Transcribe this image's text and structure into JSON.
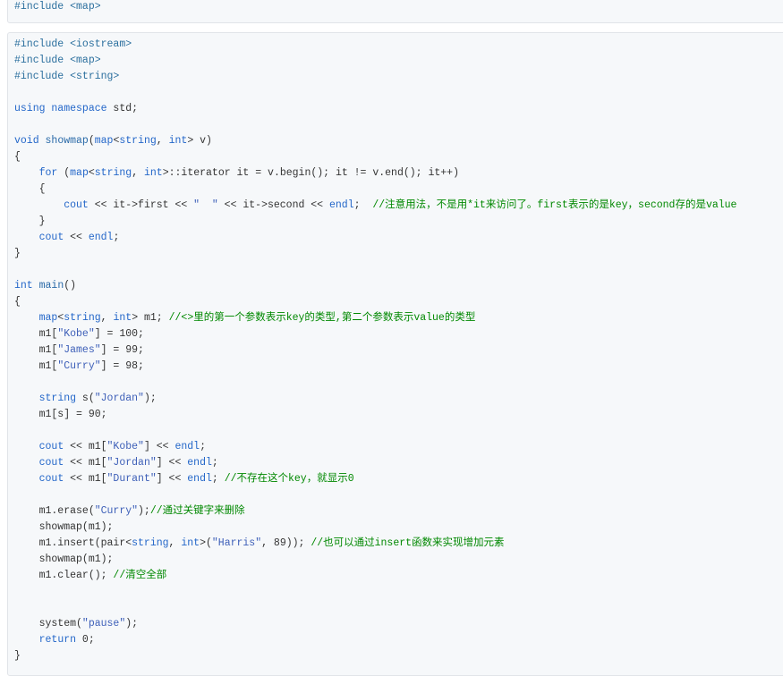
{
  "snippet": {
    "lines": [
      [
        {
          "t": "#include <map>",
          "c": "pre"
        }
      ]
    ]
  },
  "program": {
    "lines": [
      [
        {
          "t": "#include <iostream>",
          "c": "pre"
        }
      ],
      [
        {
          "t": "#include <map>",
          "c": "pre"
        }
      ],
      [
        {
          "t": "#include <string>",
          "c": "pre"
        }
      ],
      [],
      [
        {
          "t": "using namespace",
          "c": "kw"
        },
        {
          "t": " std;",
          "c": ""
        }
      ],
      [],
      [
        {
          "t": "void",
          "c": "kw"
        },
        {
          "t": " ",
          "c": ""
        },
        {
          "t": "showmap",
          "c": "fn"
        },
        {
          "t": "(",
          "c": ""
        },
        {
          "t": "map",
          "c": "kw"
        },
        {
          "t": "<",
          "c": ""
        },
        {
          "t": "string",
          "c": "kw"
        },
        {
          "t": ", ",
          "c": ""
        },
        {
          "t": "int",
          "c": "kw"
        },
        {
          "t": "> v)",
          "c": ""
        }
      ],
      [
        {
          "t": "{",
          "c": ""
        }
      ],
      [
        {
          "t": "    ",
          "c": ""
        },
        {
          "t": "for",
          "c": "kw"
        },
        {
          "t": " (",
          "c": ""
        },
        {
          "t": "map",
          "c": "kw"
        },
        {
          "t": "<",
          "c": ""
        },
        {
          "t": "string",
          "c": "kw"
        },
        {
          "t": ", ",
          "c": ""
        },
        {
          "t": "int",
          "c": "kw"
        },
        {
          "t": ">::iterator it = v.begin(); it != v.end(); it++)",
          "c": ""
        }
      ],
      [
        {
          "t": "    {",
          "c": ""
        }
      ],
      [
        {
          "t": "        ",
          "c": ""
        },
        {
          "t": "cout",
          "c": "kw"
        },
        {
          "t": " << it->first << ",
          "c": ""
        },
        {
          "t": "\"  \"",
          "c": "str"
        },
        {
          "t": " << it->second << ",
          "c": ""
        },
        {
          "t": "endl",
          "c": "kw"
        },
        {
          "t": ";  ",
          "c": ""
        },
        {
          "t": "//注意用法，不是用*it来访问了。first表示的是key，second存的是value",
          "c": "cmt"
        }
      ],
      [
        {
          "t": "    }",
          "c": ""
        }
      ],
      [
        {
          "t": "    ",
          "c": ""
        },
        {
          "t": "cout",
          "c": "kw"
        },
        {
          "t": " << ",
          "c": ""
        },
        {
          "t": "endl",
          "c": "kw"
        },
        {
          "t": ";",
          "c": ""
        }
      ],
      [
        {
          "t": "}",
          "c": ""
        }
      ],
      [],
      [
        {
          "t": "int",
          "c": "kw"
        },
        {
          "t": " ",
          "c": ""
        },
        {
          "t": "main",
          "c": "fn"
        },
        {
          "t": "()",
          "c": ""
        }
      ],
      [
        {
          "t": "{",
          "c": ""
        }
      ],
      [
        {
          "t": "    ",
          "c": ""
        },
        {
          "t": "map",
          "c": "kw"
        },
        {
          "t": "<",
          "c": ""
        },
        {
          "t": "string",
          "c": "kw"
        },
        {
          "t": ", ",
          "c": ""
        },
        {
          "t": "int",
          "c": "kw"
        },
        {
          "t": "> m1; ",
          "c": ""
        },
        {
          "t": "//<>里的第一个参数表示key的类型,第二个参数表示value的类型",
          "c": "cmt"
        }
      ],
      [
        {
          "t": "    m1[",
          "c": ""
        },
        {
          "t": "\"Kobe\"",
          "c": "str"
        },
        {
          "t": "] = 100;",
          "c": ""
        }
      ],
      [
        {
          "t": "    m1[",
          "c": ""
        },
        {
          "t": "\"James\"",
          "c": "str"
        },
        {
          "t": "] = 99;",
          "c": ""
        }
      ],
      [
        {
          "t": "    m1[",
          "c": ""
        },
        {
          "t": "\"Curry\"",
          "c": "str"
        },
        {
          "t": "] = 98;",
          "c": ""
        }
      ],
      [],
      [
        {
          "t": "    ",
          "c": ""
        },
        {
          "t": "string",
          "c": "kw"
        },
        {
          "t": " s(",
          "c": ""
        },
        {
          "t": "\"Jordan\"",
          "c": "str"
        },
        {
          "t": ");",
          "c": ""
        }
      ],
      [
        {
          "t": "    m1[s] = 90;",
          "c": ""
        }
      ],
      [],
      [
        {
          "t": "    ",
          "c": ""
        },
        {
          "t": "cout",
          "c": "kw"
        },
        {
          "t": " << m1[",
          "c": ""
        },
        {
          "t": "\"Kobe\"",
          "c": "str"
        },
        {
          "t": "] << ",
          "c": ""
        },
        {
          "t": "endl",
          "c": "kw"
        },
        {
          "t": ";",
          "c": ""
        }
      ],
      [
        {
          "t": "    ",
          "c": ""
        },
        {
          "t": "cout",
          "c": "kw"
        },
        {
          "t": " << m1[",
          "c": ""
        },
        {
          "t": "\"Jordan\"",
          "c": "str"
        },
        {
          "t": "] << ",
          "c": ""
        },
        {
          "t": "endl",
          "c": "kw"
        },
        {
          "t": ";",
          "c": ""
        }
      ],
      [
        {
          "t": "    ",
          "c": ""
        },
        {
          "t": "cout",
          "c": "kw"
        },
        {
          "t": " << m1[",
          "c": ""
        },
        {
          "t": "\"Durant\"",
          "c": "str"
        },
        {
          "t": "] << ",
          "c": ""
        },
        {
          "t": "endl",
          "c": "kw"
        },
        {
          "t": "; ",
          "c": ""
        },
        {
          "t": "//不存在这个key，就显示0",
          "c": "cmt"
        }
      ],
      [],
      [
        {
          "t": "    m1.erase(",
          "c": ""
        },
        {
          "t": "\"Curry\"",
          "c": "str"
        },
        {
          "t": ");",
          "c": ""
        },
        {
          "t": "//通过关键字来删除",
          "c": "cmt"
        }
      ],
      [
        {
          "t": "    showmap(m1);",
          "c": ""
        }
      ],
      [
        {
          "t": "    m1.insert(pair<",
          "c": ""
        },
        {
          "t": "string",
          "c": "kw"
        },
        {
          "t": ", ",
          "c": ""
        },
        {
          "t": "int",
          "c": "kw"
        },
        {
          "t": ">(",
          "c": ""
        },
        {
          "t": "\"Harris\"",
          "c": "str"
        },
        {
          "t": ", 89)); ",
          "c": ""
        },
        {
          "t": "//也可以通过insert函数来实现增加元素",
          "c": "cmt"
        }
      ],
      [
        {
          "t": "    showmap(m1);",
          "c": ""
        }
      ],
      [
        {
          "t": "    m1.clear(); ",
          "c": ""
        },
        {
          "t": "//清空全部",
          "c": "cmt"
        }
      ],
      [],
      [],
      [
        {
          "t": "    system(",
          "c": ""
        },
        {
          "t": "\"pause\"",
          "c": "str"
        },
        {
          "t": ");",
          "c": ""
        }
      ],
      [
        {
          "t": "    ",
          "c": ""
        },
        {
          "t": "return",
          "c": "kw"
        },
        {
          "t": " 0;",
          "c": ""
        }
      ],
      [
        {
          "t": "}",
          "c": ""
        }
      ]
    ]
  }
}
